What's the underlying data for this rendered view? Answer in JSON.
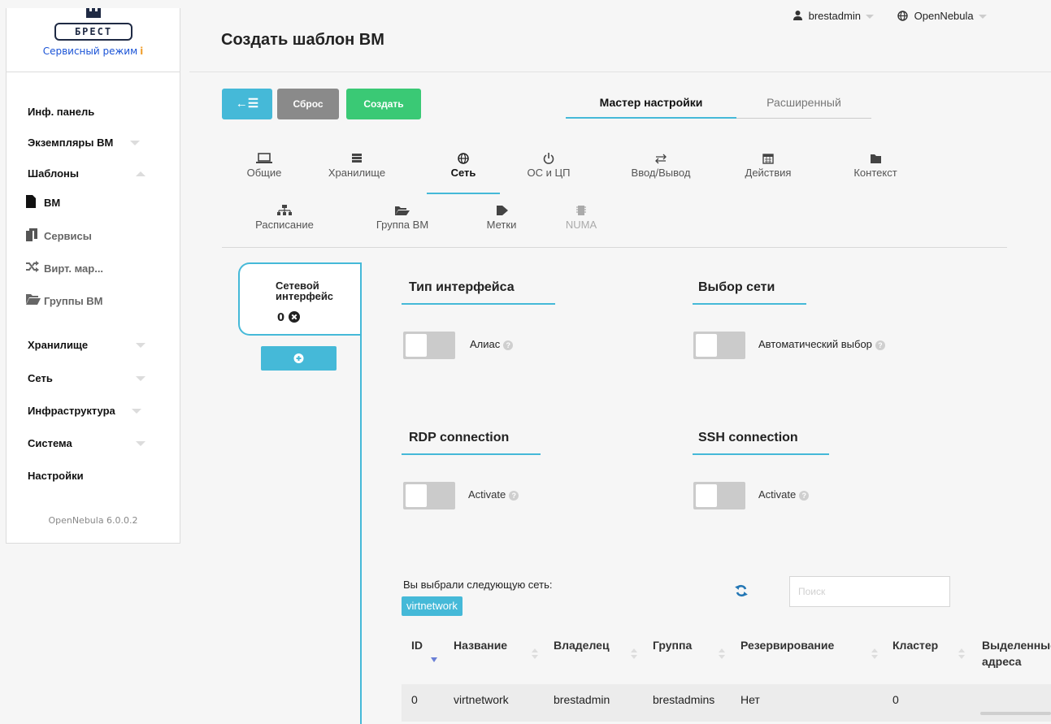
{
  "brand": {
    "logo_text": "БРЕСТ",
    "service_mode": "Сервисный режим",
    "info_icon": "info-icon"
  },
  "sidebar": {
    "items": [
      {
        "label": "Инф. панель"
      },
      {
        "label": "Экземпляры ВМ"
      },
      {
        "label": "Шаблоны"
      },
      {
        "label": "Хранилище"
      },
      {
        "label": "Сеть"
      },
      {
        "label": "Инфраструктура"
      },
      {
        "label": "Система"
      },
      {
        "label": "Настройки"
      }
    ],
    "templates_sub": [
      {
        "label": "ВМ",
        "icon": "file-icon",
        "active": true
      },
      {
        "label": "Сервисы",
        "icon": "files-icon"
      },
      {
        "label": "Вирт. мар...",
        "icon": "shuffle-icon"
      },
      {
        "label": "Группы ВМ",
        "icon": "folder-open-icon"
      }
    ],
    "version": "OpenNebula 6.0.0.2"
  },
  "header": {
    "title": "Создать шаблон ВМ",
    "user": "brestadmin",
    "zone": "OpenNebula"
  },
  "toolbar": {
    "back_label": "←☰",
    "reset_label": "Сброс",
    "create_label": "Создать"
  },
  "mode_tabs": {
    "wizard": "Мастер настройки",
    "advanced": "Расширенный"
  },
  "section_tabs": [
    {
      "label": "Общие",
      "icon": "laptop-icon"
    },
    {
      "label": "Хранилище",
      "icon": "storage-icon"
    },
    {
      "label": "Сеть",
      "icon": "globe-icon",
      "active": true
    },
    {
      "label": "ОС и ЦП",
      "icon": "power-icon"
    },
    {
      "label": "Ввод/Вывод",
      "icon": "exchange-icon"
    },
    {
      "label": "Действия",
      "icon": "calendar-icon"
    },
    {
      "label": "Контекст",
      "icon": "folder-icon"
    },
    {
      "label": "Расписание",
      "icon": "sitemap-icon"
    },
    {
      "label": "Группа ВМ",
      "icon": "folder-open-icon"
    },
    {
      "label": "Метки",
      "icon": "tag-icon"
    },
    {
      "label": "NUMA",
      "icon": "chip-icon",
      "disabled": true
    }
  ],
  "nic": {
    "tab_label": "Сетевой интерфейс",
    "tab_index": "0"
  },
  "sections": {
    "iface_type": {
      "title": "Тип интерфейса",
      "switch_label": "Алиас"
    },
    "net_select": {
      "title": "Выбор сети",
      "switch_label": "Автоматический выбор"
    },
    "rdp": {
      "title": "RDP connection",
      "switch_label": "Activate"
    },
    "ssh": {
      "title": "SSH connection",
      "switch_label": "Activate"
    }
  },
  "network": {
    "selected_text": "Вы выбрали следующую сеть:",
    "selected_name": "virtnetwork",
    "search_placeholder": "Поиск",
    "columns": [
      "ID",
      "Название",
      "Владелец",
      "Группа",
      "Резервирование",
      "Кластер",
      "Выделенные адреса"
    ],
    "rows": [
      {
        "id": "0",
        "name": "virtnetwork",
        "owner": "brestadmin",
        "group": "brestadmins",
        "reservation": "Нет",
        "cluster": "0"
      }
    ]
  }
}
